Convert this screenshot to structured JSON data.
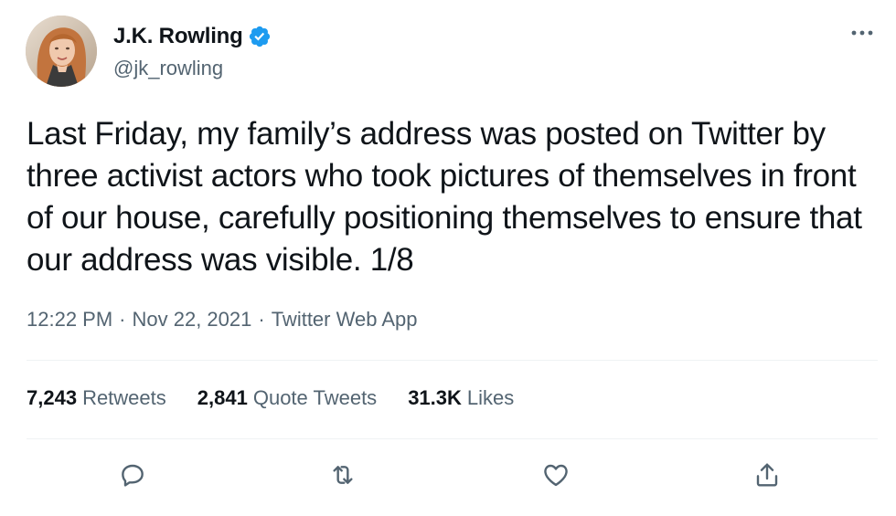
{
  "author": {
    "display_name": "J.K. Rowling",
    "handle": "@jk_rowling",
    "verified": true,
    "avatar": "profile-photo"
  },
  "tweet": {
    "text": "Last Friday, my family’s address was posted on Twitter by three activist actors who took pictures of themselves in front of our house, carefully positioning themselves to ensure that our address was visible. 1/8",
    "time": "12:22 PM",
    "separator": "·",
    "date": "Nov 22, 2021",
    "source": "Twitter Web App"
  },
  "stats": {
    "retweets_count": "7,243",
    "retweets_label": "Retweets",
    "quotes_count": "2,841",
    "quotes_label": "Quote Tweets",
    "likes_count": "31.3K",
    "likes_label": "Likes"
  },
  "actions": [
    {
      "icon": "reply-icon"
    },
    {
      "icon": "retweet-icon"
    },
    {
      "icon": "like-icon"
    },
    {
      "icon": "share-icon"
    }
  ],
  "colors": {
    "verified_blue": "#1d9bf0",
    "text_primary": "#0f1419",
    "text_secondary": "#536471",
    "divider": "#eff3f4"
  }
}
